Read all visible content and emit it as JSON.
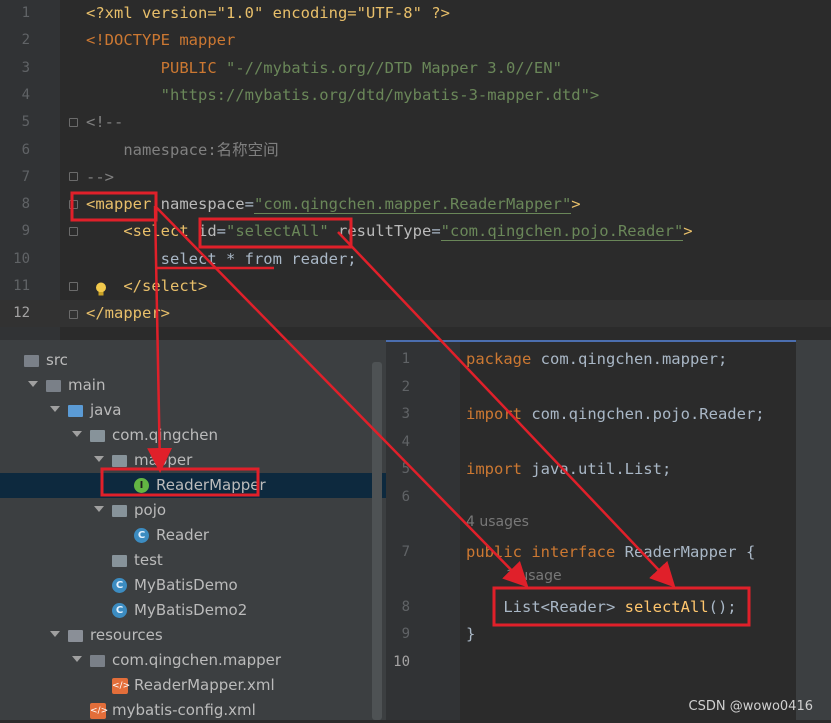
{
  "xml_editor": {
    "lines": [
      {
        "n": "1",
        "tokens": [
          [
            "<?xml version=\"1.0\" encoding=\"UTF-8\" ?>",
            "t-pi"
          ]
        ]
      },
      {
        "n": "2",
        "tokens": [
          [
            "<!DOCTYPE mapper",
            "t-doc"
          ]
        ]
      },
      {
        "n": "3",
        "tokens": [
          [
            "        PUBLIC ",
            "t-doc"
          ],
          [
            "\"-//mybatis.org//DTD Mapper 3.0//EN\"",
            "t-str"
          ]
        ]
      },
      {
        "n": "4",
        "tokens": [
          [
            "        \"https://mybatis.org/dtd/mybatis-3-mapper.dtd\">",
            "t-str"
          ]
        ]
      },
      {
        "n": "5",
        "tokens": [
          [
            "<!--",
            "t-cmt"
          ]
        ]
      },
      {
        "n": "6",
        "tokens": [
          [
            "    namespace:名称空间",
            "t-cmt"
          ]
        ]
      },
      {
        "n": "7",
        "tokens": [
          [
            "-->",
            "t-cmt"
          ]
        ]
      },
      {
        "n": "8",
        "tokens": [
          [
            "<mapper ",
            "t-tag"
          ],
          [
            "namespace",
            "t-attr"
          ],
          [
            "=",
            "t-sql"
          ],
          [
            "\"com.qingchen.mapper.ReaderMapper\"",
            "t-str"
          ],
          [
            ">",
            "t-tag"
          ]
        ]
      },
      {
        "n": "9",
        "tokens": [
          [
            "    <select ",
            "t-tag"
          ],
          [
            "id",
            "t-attr"
          ],
          [
            "=",
            "t-sql"
          ],
          [
            "\"selectAll\"",
            "t-str"
          ],
          [
            " resultType",
            "t-attr"
          ],
          [
            "=",
            "t-sql"
          ],
          [
            "\"com.qingchen.pojo.Reader\"",
            "t-str"
          ],
          [
            ">",
            "t-tag"
          ]
        ]
      },
      {
        "n": "10",
        "tokens": [
          [
            "        select * from reader;",
            "t-sql"
          ]
        ]
      },
      {
        "n": "11",
        "tokens": [
          [
            "    </select>",
            "t-tag"
          ]
        ]
      },
      {
        "n": "12",
        "tokens": [
          [
            "</mapper>",
            "t-tag"
          ]
        ]
      }
    ]
  },
  "project_tree": {
    "items": [
      {
        "label": "src",
        "icon": "folder-icon"
      },
      {
        "label": "main",
        "icon": "folder-icon"
      },
      {
        "label": "java",
        "icon": "source-folder-icon"
      },
      {
        "label": "com.qingchen",
        "icon": "package-icon"
      },
      {
        "label": "mapper",
        "icon": "package-icon"
      },
      {
        "label": "ReaderMapper",
        "icon": "interface-icon"
      },
      {
        "label": "pojo",
        "icon": "package-icon"
      },
      {
        "label": "Reader",
        "icon": "class-icon"
      },
      {
        "label": "test",
        "icon": "package-icon"
      },
      {
        "label": "MyBatisDemo",
        "icon": "runnable-class-icon"
      },
      {
        "label": "MyBatisDemo2",
        "icon": "runnable-class-icon"
      },
      {
        "label": "resources",
        "icon": "resources-folder-icon"
      },
      {
        "label": "com.qingchen.mapper",
        "icon": "folder-icon"
      },
      {
        "label": "ReaderMapper.xml",
        "icon": "xml-file-icon"
      },
      {
        "label": "mybatis-config.xml",
        "icon": "xml-file-icon"
      }
    ],
    "icon_letters": {
      "interface": "I",
      "class": "C"
    }
  },
  "java_editor": {
    "line_numbers": [
      "1",
      "2",
      "3",
      "4",
      "5",
      "6",
      "7",
      "8",
      "9",
      "10"
    ],
    "lines": [
      {
        "tokens": [
          [
            "package ",
            "t-kw"
          ],
          [
            "com.qingchen.mapper;",
            "t-sql"
          ]
        ]
      },
      {
        "tokens": []
      },
      {
        "tokens": [
          [
            "import ",
            "t-kw"
          ],
          [
            "com.qingchen.pojo.Reader;",
            "t-sql"
          ]
        ]
      },
      {
        "tokens": []
      },
      {
        "tokens": [
          [
            "import ",
            "t-kw"
          ],
          [
            "java.util.List;",
            "t-sql"
          ]
        ]
      },
      {
        "tokens": []
      },
      {
        "tokens": [
          [
            "public interface ",
            "t-kw"
          ],
          [
            "ReaderMapper {",
            "t-sql"
          ]
        ]
      },
      {
        "tokens": [
          [
            "    List<Reader> ",
            "t-sql"
          ],
          [
            "selectAll",
            "t-method"
          ],
          [
            "();",
            "t-sql"
          ]
        ]
      },
      {
        "tokens": [
          [
            "}",
            "t-sql"
          ]
        ]
      },
      {
        "tokens": []
      }
    ],
    "usage_hints": [
      "4 usages",
      "1 usage"
    ]
  },
  "watermark": "CSDN @wowo0416",
  "colors": {
    "annotation": "#e0202a",
    "editor_bg": "#2b2b2b",
    "tree_bg": "#3c3f41",
    "selection": "#0d293e"
  }
}
